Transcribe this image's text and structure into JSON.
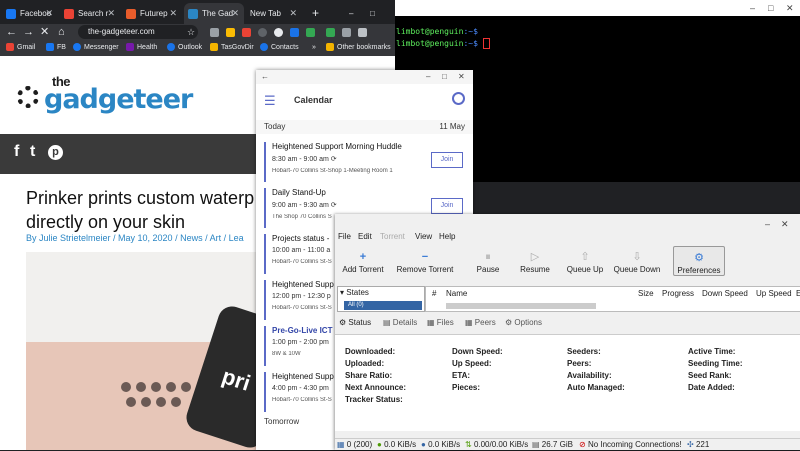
{
  "chrome": {
    "tabs": [
      {
        "title": "Faceboo",
        "color": "#1877f2"
      },
      {
        "title": "Search r",
        "color": "#ea4335"
      },
      {
        "title": "Futurep",
        "color": "#e85c2b"
      },
      {
        "title": "The Gad",
        "color": "#2b86c4"
      },
      {
        "title": "New Tab",
        "color": ""
      }
    ],
    "new_tab": "+",
    "url": "the-gadgeteer.com",
    "bookmarks": [
      "Gmail",
      "FB",
      "Messenger",
      "Health",
      "Outlook",
      "TasGovDir",
      "Contacts"
    ],
    "bookmarks_more": "»",
    "other_bookmarks": "Other bookmarks"
  },
  "site": {
    "logo_the": "the",
    "logo_brand": "gadgeteer",
    "social": [
      "f",
      "t",
      "p"
    ],
    "title": "Prinker prints custom waterp directly on your skin",
    "byline": "By Julie Strietelmeier / May 10, 2020 / News / Art / Lea",
    "device_text": "pri"
  },
  "terminal": {
    "lines": [
      {
        "user": "limbot@penguin",
        "path": ":~$"
      },
      {
        "user": "limbot@penguin",
        "path": ":~$"
      }
    ]
  },
  "calendar": {
    "title": "Calendar",
    "today_label": "Today",
    "today_date": "11 May",
    "tomorrow_label": "Tomorrow",
    "join_label": "Join",
    "events": [
      {
        "title": "Heightened Support Morning Huddle",
        "time": "8:30 am - 9:00 am",
        "location": "Hobart-70 Collins St-Shop 1-Meeting Room 1",
        "join": true
      },
      {
        "title": "Daily Stand-Up",
        "time": "9:00 am - 9:30 am",
        "location": "The Shop 70 Collins S",
        "join": true
      },
      {
        "title": "Projects status -",
        "time": "10:00 am - 11:00 a",
        "location": "Hobart-70 Collins St-S",
        "join": false
      },
      {
        "title": "Heightened Supp",
        "time": "12:00 pm - 12:30 p",
        "location": "Hobart-70 Collins St-S",
        "join": false
      },
      {
        "title": "Pre-Go-Live ICT",
        "time": "1:00 pm - 2:00 pm",
        "location": "8W & 10W",
        "join": false
      },
      {
        "title": "Heightened Supp",
        "time": "4:00 pm - 4:30 pm",
        "location": "Hobart-70 Collins St-S",
        "join": false
      }
    ]
  },
  "deluge": {
    "menu": [
      "File",
      "Edit",
      "Torrent",
      "View",
      "Help"
    ],
    "toolbar": [
      "Add Torrent",
      "Remove Torrent",
      "Pause",
      "Resume",
      "Queue Up",
      "Queue Down",
      "Preferences"
    ],
    "sidebar_header": "States",
    "sidebar_item": "All (0)",
    "columns": [
      "#",
      "Name",
      "Size",
      "Progress",
      "Down Speed",
      "Up Speed",
      "E"
    ],
    "tabs": [
      "Status",
      "Details",
      "Files",
      "Peers",
      "Options"
    ],
    "stats": [
      [
        "Downloaded:",
        "Down Speed:",
        "Seeders:",
        "Active Time:"
      ],
      [
        "Uploaded:",
        "Up Speed:",
        "Peers:",
        "Seeding Time:"
      ],
      [
        "Share Ratio:",
        "ETA:",
        "Availability:",
        "Seed Rank:"
      ],
      [
        "Next Announce:",
        "Pieces:",
        "Auto Managed:",
        "Date Added:"
      ],
      [
        "Tracker Status:",
        "",
        "",
        ""
      ]
    ],
    "status": [
      "0 (200)",
      "0.0 KiB/s",
      "0.0 KiB/s",
      "0.00/0.00 KiB/s",
      "26.7 GiB",
      "No Incoming Connections!",
      "221"
    ]
  }
}
